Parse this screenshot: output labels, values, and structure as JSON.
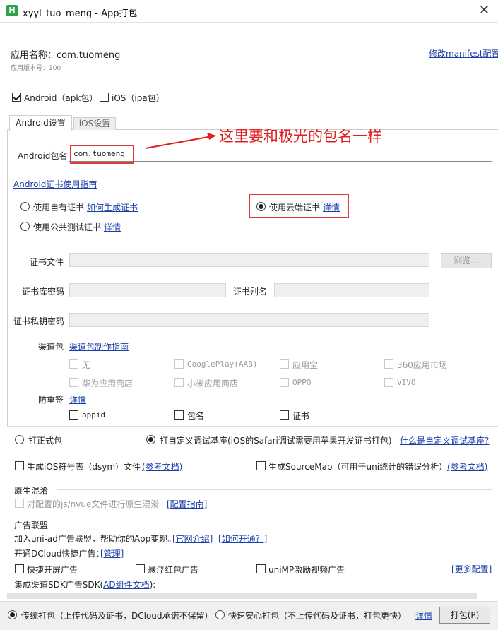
{
  "window": {
    "title": "xyyl_tuo_meng - App打包",
    "icon_letter": "H",
    "close_glyph": "✕"
  },
  "app": {
    "name_label": "应用名称：com.tuomeng",
    "version_label": "应用版本号：100",
    "modify_manifest_link": "修改manifest配置"
  },
  "platforms": {
    "android": "Android（apk包）",
    "ios": "iOS（ipa包）"
  },
  "tabs": {
    "android": "Android设置",
    "ios": "iOS设置"
  },
  "android": {
    "package_label": "Android包名",
    "package_value": "com.tuomeng",
    "annotation": "这里要和极光的包名一样",
    "cert_guide_link": "Android证书使用指南",
    "cert_own": "使用自有证书",
    "cert_own_link": "如何生成证书",
    "cert_cloud": "使用云端证书",
    "cert_cloud_link": "详情",
    "cert_public": "使用公共测试证书",
    "cert_public_link": "详情",
    "cert_file_label": "证书文件",
    "browse_button": "浏览...",
    "keystore_pwd_label": "证书库密码",
    "alias_label": "证书别名",
    "key_pwd_label": "证书私钥密码",
    "channel_label": "渠道包",
    "channel_link": "渠道包制作指南",
    "channels": [
      "无",
      "GooglePlay(AAB)",
      "应用宝",
      "360应用市场",
      "华为应用商店",
      "小米应用商店",
      "OPPO",
      "VIVO"
    ],
    "anti_label": "防重签",
    "anti_link": "详情",
    "anti_options": [
      "appid",
      "包名",
      "证书"
    ]
  },
  "build": {
    "release": "打正式包",
    "custom_base": "打自定义调试基座(iOS的Safari调试需要用苹果开发证书打包)",
    "custom_base_link": "什么是自定义调试基座?",
    "dsym": "生成iOS符号表（dsym）文件",
    "dsym_link": "(参考文档)",
    "sourcemap": "生成SourceMap（可用于uni统计的错误分析）",
    "sourcemap_link": "(参考文档)"
  },
  "obfuscation": {
    "title": "原生混淆",
    "option": "对配置的js/nvue文件进行原生混淆",
    "link": "[配置指南]"
  },
  "ads": {
    "title": "广告联盟",
    "intro": "加入uni-ad广告联盟，帮助你的App变现。",
    "link_official": "[官网介绍]",
    "link_how": "[如何开通？]",
    "dcloud_label": "开通DCloud快捷广告：",
    "dcloud_link": "[管理]",
    "splash": "快捷开屏广告",
    "float_red": "悬浮红包广告",
    "unimp_video": "uniMP激励视频广告",
    "more_link": "[更多配置]",
    "sdk_label_pre": "集成渠道SDK广告SDK(",
    "sdk_link": "AD组件文档",
    "sdk_label_post": "):"
  },
  "bottom": {
    "traditional": "传统打包（上传代码及证书，DCloud承诺不保留）",
    "fast_safe": "快速安心打包（不上传代码及证书，打包更快）",
    "details_link": "详情",
    "pack_button": "打包(P)"
  },
  "colors": {
    "accent_red": "#e23a3a",
    "link_blue": "#1a3ea8",
    "icon_green": "#2fa34a"
  }
}
